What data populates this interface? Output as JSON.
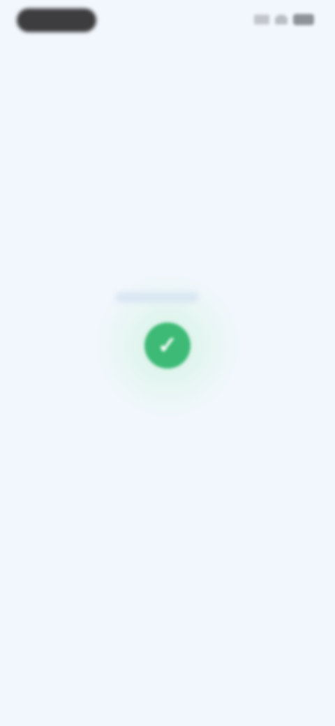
{
  "status_bar": {
    "time": "",
    "icons": [
      "cellular-signal-icon",
      "wifi-icon",
      "battery-icon"
    ]
  },
  "success": {
    "icon": "check-icon",
    "icon_glyph": "✓",
    "icon_color": "#3dba76",
    "title": "",
    "subtitle": ""
  },
  "colors": {
    "background": "#f2f7fd",
    "accent": "#8fb3e6"
  }
}
